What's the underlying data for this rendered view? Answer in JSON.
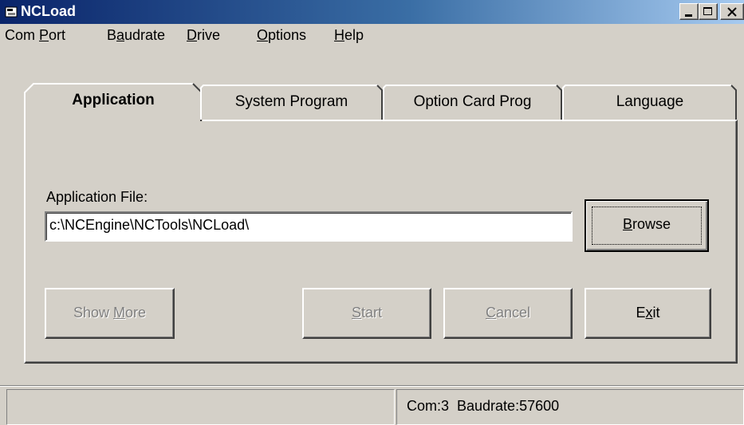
{
  "window": {
    "title": "NCLoad",
    "app_icon": "ncload-app-icon"
  },
  "menu": [
    {
      "pre": "Com ",
      "mnemonic": "P",
      "post": "ort"
    },
    {
      "pre": "B",
      "mnemonic": "a",
      "post": "udrate"
    },
    {
      "pre": "",
      "mnemonic": "D",
      "post": "rive"
    },
    {
      "pre": "",
      "mnemonic": "O",
      "post": "ptions"
    },
    {
      "pre": "",
      "mnemonic": "H",
      "post": "elp"
    }
  ],
  "tabs": [
    {
      "label": "Application",
      "active": true
    },
    {
      "label": "System Program",
      "active": false
    },
    {
      "label": "Option Card Prog",
      "active": false
    },
    {
      "label": "Language",
      "active": false
    }
  ],
  "application": {
    "file_label": "Application File:",
    "file_value": "c:\\NCEngine\\NCTools\\NCLoad\\",
    "browse": {
      "pre": "",
      "mnemonic": "B",
      "post": "rowse"
    },
    "show_more": {
      "pre": "Show ",
      "mnemonic": "M",
      "post": "ore"
    },
    "start": {
      "pre": "",
      "mnemonic": "S",
      "post": "tart"
    },
    "cancel": {
      "pre": "",
      "mnemonic": "C",
      "post": "ancel"
    },
    "exit": {
      "pre": "E",
      "mnemonic": "x",
      "post": "it"
    }
  },
  "status": {
    "left": "",
    "right": "Com:3  Baudrate:57600"
  },
  "colors": {
    "title_gradient_start": "#0a246a",
    "title_gradient_end": "#a6caf0",
    "face": "#d4d0c8",
    "disabled_text": "#808080"
  }
}
